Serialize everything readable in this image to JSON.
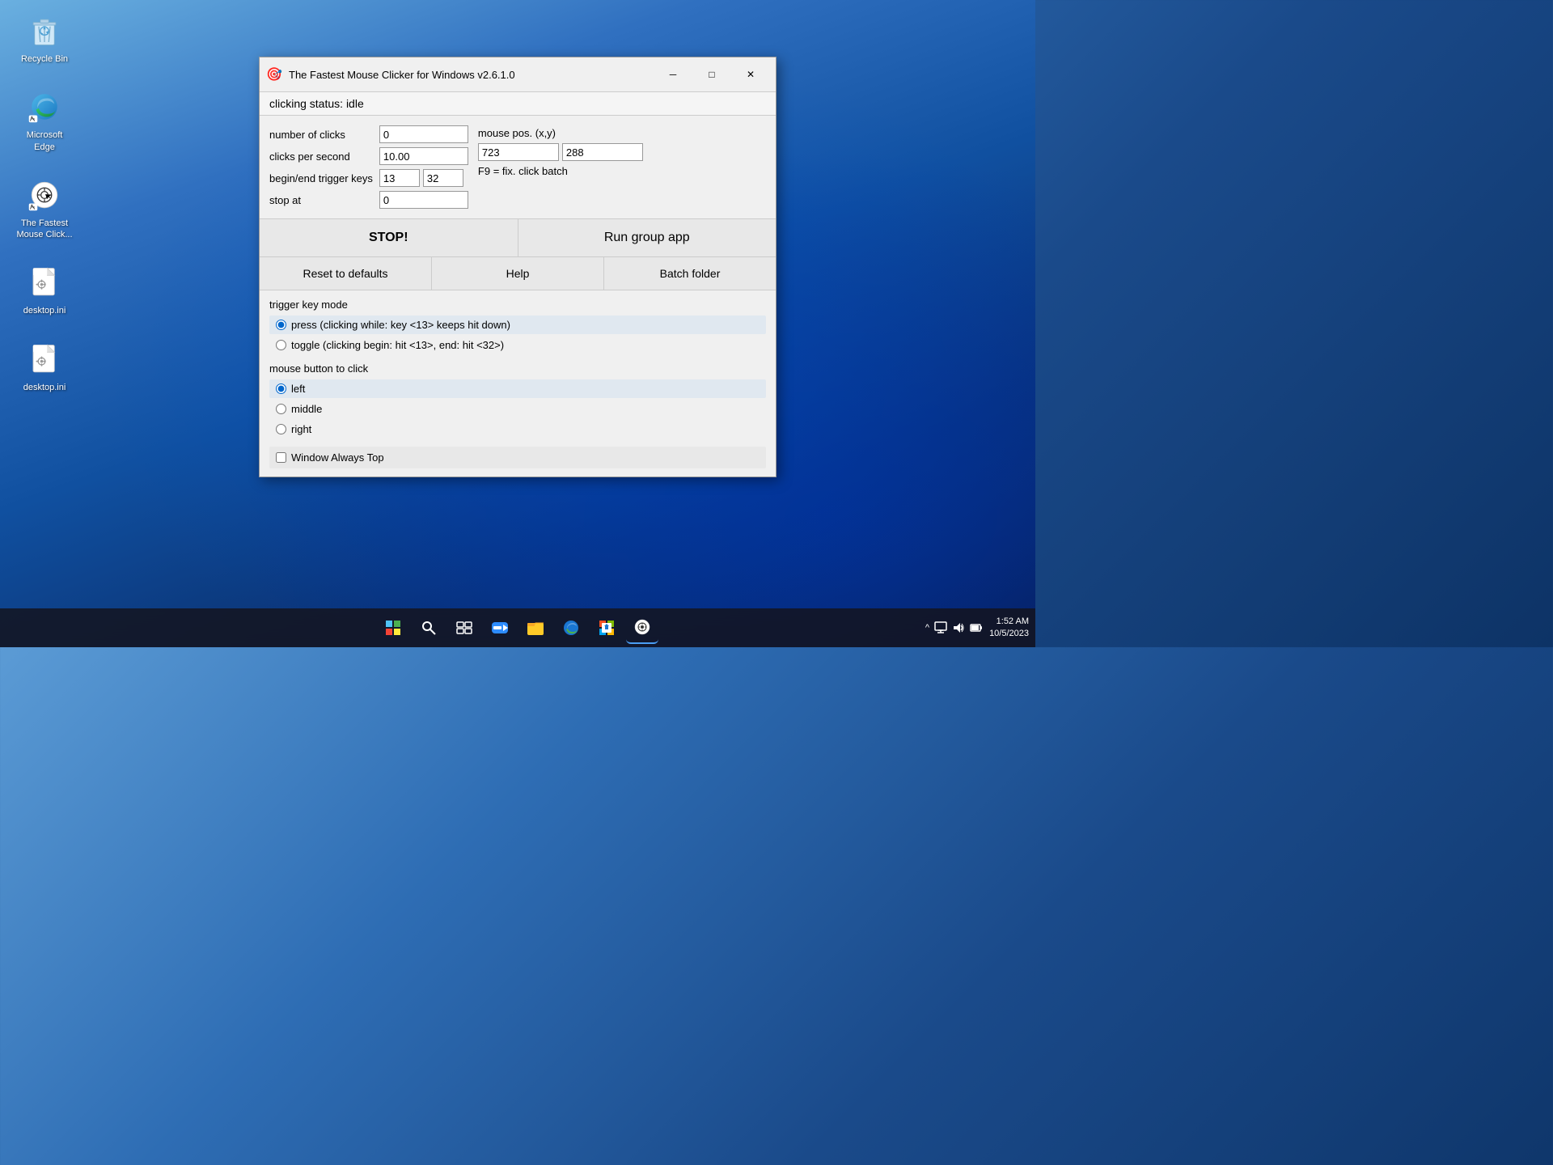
{
  "desktop": {
    "icons": [
      {
        "id": "recycle-bin",
        "label": "Recycle Bin",
        "type": "recycle"
      },
      {
        "id": "microsoft-edge",
        "label": "Microsoft Edge",
        "type": "edge"
      },
      {
        "id": "mouse-clicker",
        "label": "The Fastest Mouse Click...",
        "type": "mouse"
      },
      {
        "id": "desktop-ini-1",
        "label": "desktop.ini",
        "type": "file"
      },
      {
        "id": "desktop-ini-2",
        "label": "desktop.ini",
        "type": "file"
      }
    ]
  },
  "window": {
    "title": "The Fastest Mouse Clicker for Windows v2.6.1.0",
    "icon": "🎯",
    "status_label": "clicking status:",
    "status_value": "idle",
    "fields": {
      "num_clicks_label": "number of clicks",
      "num_clicks_value": "0",
      "clicks_per_sec_label": "clicks per second",
      "clicks_per_sec_value": "10.00",
      "trigger_keys_label": "begin/end trigger keys",
      "trigger_key1": "13",
      "trigger_key2": "32",
      "stop_at_label": "stop at",
      "stop_at_value": "0",
      "mouse_pos_label": "mouse pos. (x,y)",
      "mouse_x": "723",
      "mouse_y": "288",
      "fix_click_batch": "F9 = fix. click batch"
    },
    "buttons": {
      "stop": "STOP!",
      "run_group": "Run group app",
      "reset": "Reset to defaults",
      "help": "Help",
      "batch_folder": "Batch folder"
    },
    "trigger_mode": {
      "title": "trigger key mode",
      "option1": "press (clicking while: key <13> keeps hit down)",
      "option2": "toggle (clicking begin: hit <13>, end: hit <32>)",
      "option1_selected": true,
      "option2_selected": false
    },
    "mouse_button": {
      "title": "mouse button to click",
      "left_selected": true,
      "middle_selected": false,
      "right_selected": false,
      "left_label": "left",
      "middle_label": "middle",
      "right_label": "right"
    },
    "always_top": {
      "label": "Window Always Top",
      "checked": false
    }
  },
  "taskbar": {
    "items": [
      {
        "id": "start",
        "icon": "⊞",
        "label": "Start"
      },
      {
        "id": "search",
        "icon": "🔍",
        "label": "Search"
      },
      {
        "id": "task-view",
        "icon": "⧉",
        "label": "Task View"
      },
      {
        "id": "zoom",
        "icon": "📹",
        "label": "Zoom"
      },
      {
        "id": "file-explorer",
        "icon": "📁",
        "label": "File Explorer"
      },
      {
        "id": "edge",
        "icon": "🌐",
        "label": "Microsoft Edge"
      },
      {
        "id": "store",
        "icon": "🛍",
        "label": "Microsoft Store"
      },
      {
        "id": "mouse-clicker-tb",
        "icon": "🎯",
        "label": "Mouse Clicker",
        "active": true
      }
    ],
    "tray": {
      "chevron": "^",
      "monitor": "🖥",
      "volume": "🔊",
      "battery": "🔋"
    },
    "time": "1:52 AM",
    "date": "10/5/2023"
  }
}
